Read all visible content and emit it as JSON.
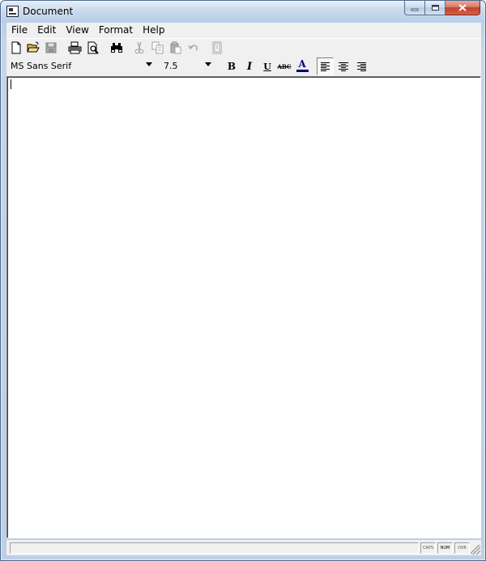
{
  "window": {
    "title": "Document",
    "caption_buttons": {
      "minimize": "▭",
      "maximize": "▢",
      "close": "✕"
    }
  },
  "menubar": {
    "items": [
      {
        "label": "File"
      },
      {
        "label": "Edit"
      },
      {
        "label": "View"
      },
      {
        "label": "Format"
      },
      {
        "label": "Help"
      }
    ]
  },
  "toolbar": {
    "buttons": [
      {
        "icon": "new-document-icon"
      },
      {
        "icon": "open-folder-icon"
      },
      {
        "icon": "save-icon",
        "enabled": false
      },
      {
        "icon": "print-icon"
      },
      {
        "icon": "print-preview-icon"
      },
      {
        "icon": "find-binoculars-icon"
      },
      {
        "icon": "cut-icon",
        "enabled": false
      },
      {
        "icon": "copy-icon",
        "enabled": false
      },
      {
        "icon": "paste-icon",
        "enabled": false
      },
      {
        "icon": "undo-icon",
        "enabled": false
      },
      {
        "icon": "date-time-icon",
        "enabled": false
      }
    ]
  },
  "format_bar": {
    "font_name": "MS Sans Serif",
    "font_size": "7.5",
    "bold_label": "B",
    "italic_label": "I",
    "underline_label": "U",
    "strikeout_label": "ABC",
    "color_label": "A",
    "color_swatch": "#000080",
    "alignment": "left"
  },
  "editor": {
    "text": ""
  },
  "statusbar": {
    "message": "",
    "indicators": [
      {
        "label": "CAPS",
        "active": false
      },
      {
        "label": "NUM",
        "active": true
      },
      {
        "label": "OVR",
        "active": false
      }
    ]
  }
}
